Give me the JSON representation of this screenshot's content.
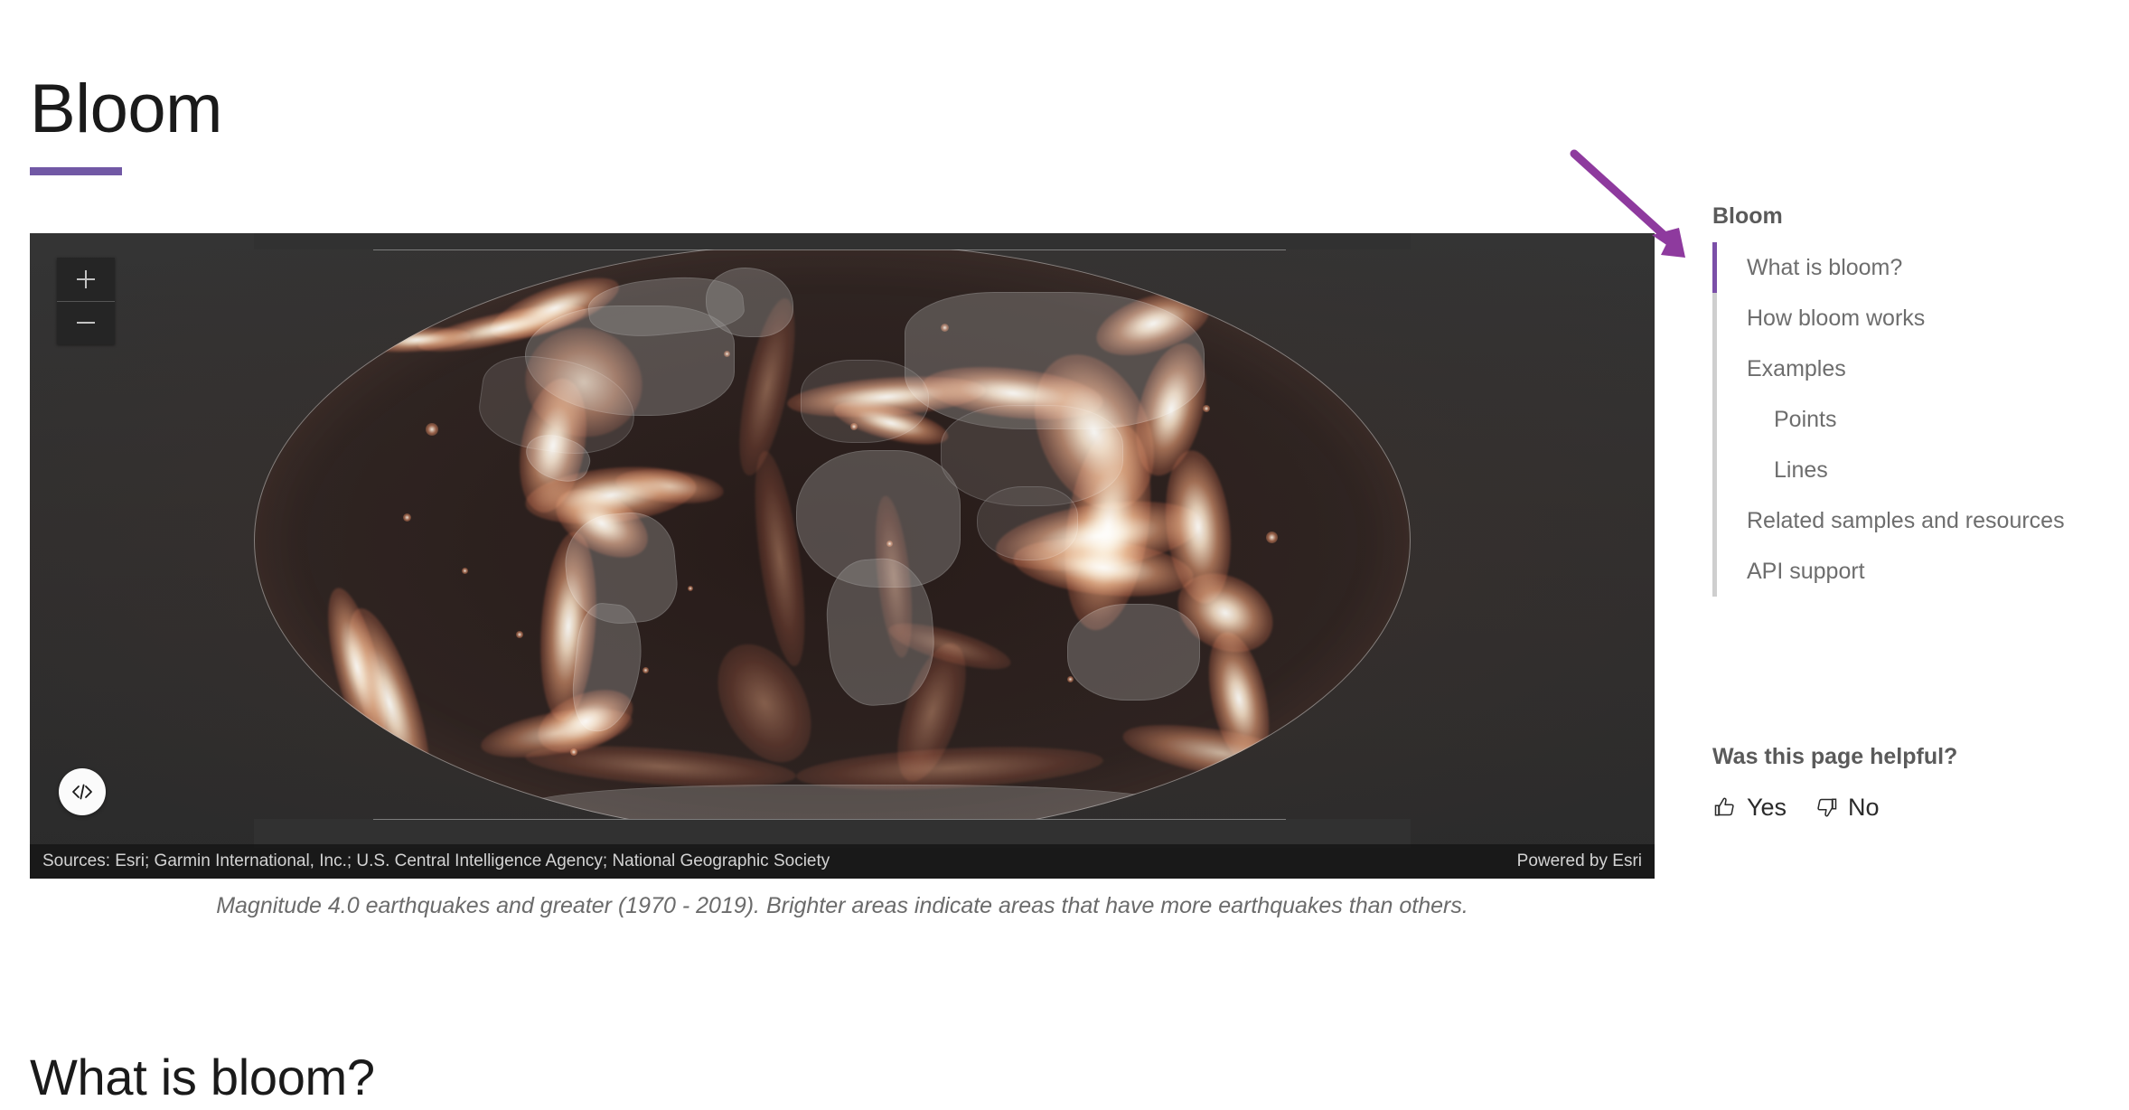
{
  "page": {
    "title": "Bloom",
    "accent_color": "#7158a5",
    "section_heading": "What is bloom?"
  },
  "map": {
    "zoom_in_label": "+",
    "zoom_out_label": "−",
    "code_button_label": "</>",
    "attribution": "Sources: Esri; Garmin International, Inc.; U.S. Central Intelligence Agency; National Geographic Society",
    "powered_by": "Powered by Esri",
    "caption": "Magnitude 4.0 earthquakes and greater (1970 - 2019). Brighter areas indicate areas that have more earthquakes than others.",
    "background_color": "#313131",
    "glow_color": "#ff9b6b"
  },
  "sidebar": {
    "title": "Bloom",
    "active_index": 0,
    "items": [
      {
        "label": "What is bloom?",
        "level": 1,
        "active": true
      },
      {
        "label": "How bloom works",
        "level": 1,
        "active": false
      },
      {
        "label": "Examples",
        "level": 1,
        "active": false
      },
      {
        "label": "Points",
        "level": 2,
        "active": false
      },
      {
        "label": "Lines",
        "level": 2,
        "active": false
      },
      {
        "label": "Related samples and resources",
        "level": 1,
        "active": false
      },
      {
        "label": "API support",
        "level": 1,
        "active": false
      }
    ]
  },
  "feedback": {
    "question": "Was this page helpful?",
    "yes_label": "Yes",
    "no_label": "No"
  },
  "annotation": {
    "color": "#8e3a9e",
    "type": "arrow",
    "points_to": "what-is-bloom-active-nav-item"
  }
}
